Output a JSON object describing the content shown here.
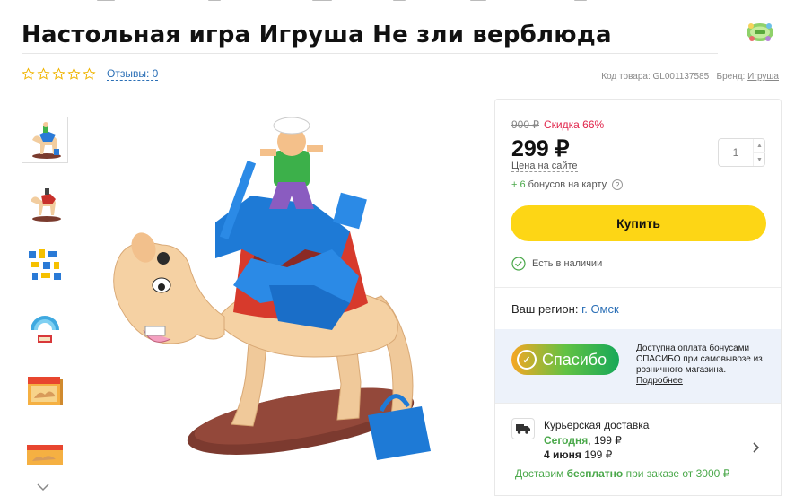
{
  "product": {
    "title": "Настольная игра Игруша Не зли верблюда",
    "reviews_label": "Отзывы: 0",
    "rating_stars": 0,
    "rating_max": 5,
    "code_label": "Код товара: GL001137585",
    "brand_label": "Бренд:",
    "brand_value": "Игруша"
  },
  "thumbnails": [
    {
      "name": "camel-game-thumb",
      "active": true
    },
    {
      "name": "camel-side-thumb",
      "active": false
    },
    {
      "name": "accessories-thumb",
      "active": false
    },
    {
      "name": "cards-thumb",
      "active": false
    },
    {
      "name": "box-front-thumb",
      "active": false
    },
    {
      "name": "box-side-thumb",
      "active": false
    }
  ],
  "purchase": {
    "old_price": "900 ₽",
    "discount": "Скидка 66%",
    "price": "299 ₽",
    "price_note": "Цена на сайте",
    "quantity": "1",
    "bonus_plus": "+ 6",
    "bonus_text": "бонусов на карту",
    "help_symbol": "?",
    "buy_label": "Купить",
    "stock_label": "Есть в наличии"
  },
  "region": {
    "label": "Ваш регион:",
    "city": "г. Омск"
  },
  "spasibo": {
    "logo_text": "Спасибо",
    "description": "Доступна оплата бонусами СПАСИБО при самовывозе из розничного магазина.",
    "more_link": "Подробнее"
  },
  "delivery": {
    "title": "Курьерская доставка",
    "today_label": "Сегодня",
    "today_price": ", 199 ₽",
    "date_label": "4 июня",
    "date_price": " 199 ₽",
    "free_prefix": "Доставим ",
    "free_bold": "бесплатно",
    "free_suffix": " при заказе от 3000 ₽"
  },
  "colors": {
    "accent_yellow": "#fdd615",
    "link_blue": "#2b6fb6",
    "discount_red": "#e0244a",
    "success_green": "#4aa84a",
    "spasibo_bg": "#edf2fa"
  },
  "icons": [
    "star-icon",
    "chevron-down-icon",
    "help-icon",
    "check-circle-icon",
    "truck-icon",
    "chevron-right-icon",
    "brand-logo-icon"
  ]
}
